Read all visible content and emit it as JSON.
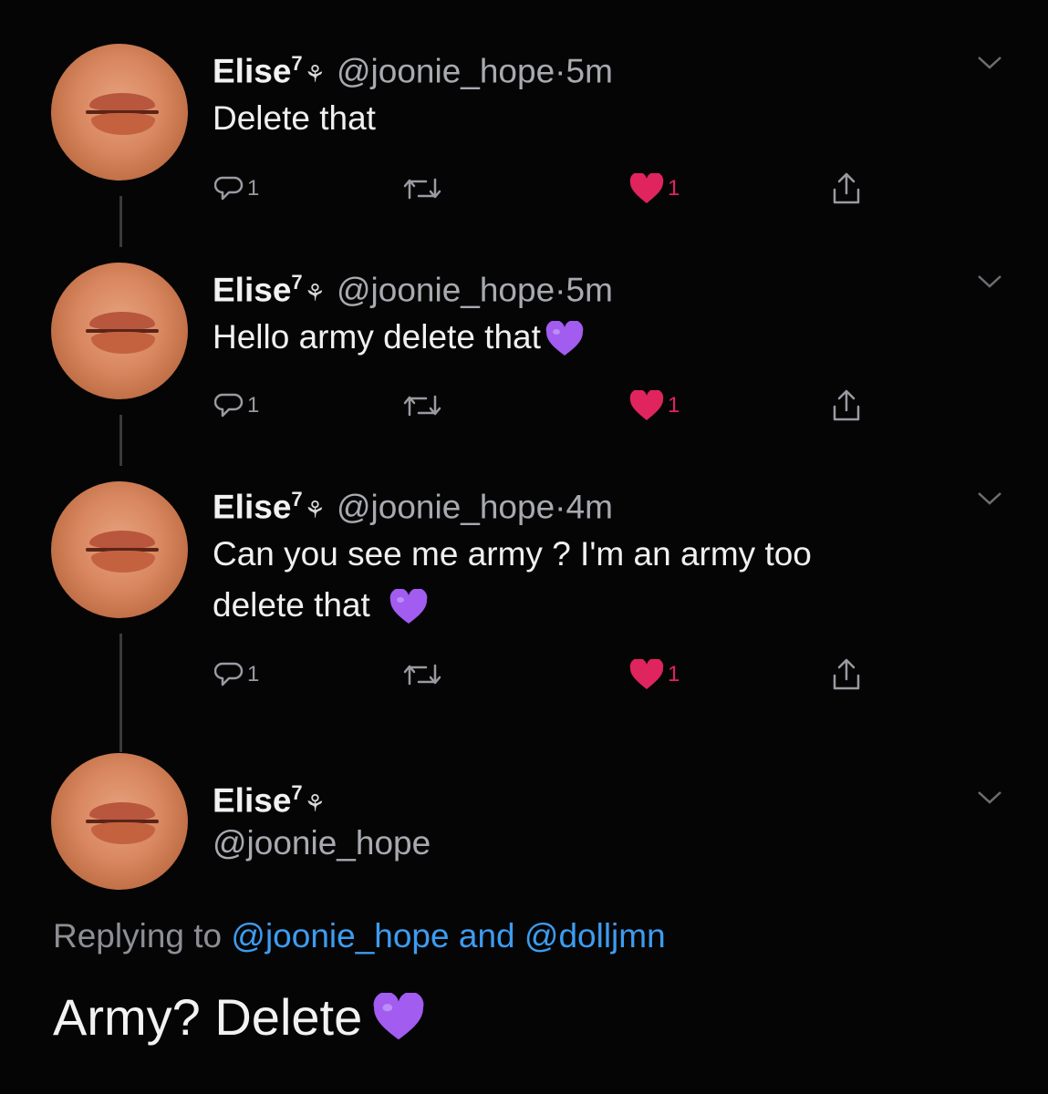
{
  "tweets": [
    {
      "name": "Elise",
      "superscript": "7",
      "rose": "⚘",
      "handle": "@joonie_hope",
      "dot": "·",
      "time": "5m",
      "text": "Delete that",
      "has_heart_emoji": false,
      "reply_count": "1",
      "like_count": "1"
    },
    {
      "name": "Elise",
      "superscript": "7",
      "rose": "⚘",
      "handle": "@joonie_hope",
      "dot": "·",
      "time": "5m",
      "text": "Hello army delete that",
      "has_heart_emoji": true,
      "reply_count": "1",
      "like_count": "1"
    },
    {
      "name": "Elise",
      "superscript": "7",
      "rose": "⚘",
      "handle": "@joonie_hope",
      "dot": "·",
      "time": "4m",
      "text_line1": "Can you see me army ? I'm an army too",
      "text_line2": "delete that",
      "has_heart_emoji": true,
      "reply_count": "1",
      "like_count": "1"
    }
  ],
  "main_tweet": {
    "name": "Elise",
    "superscript": "7",
    "rose": "⚘",
    "handle": "@joonie_hope",
    "replying_prefix": "Replying to",
    "mention1": "@joonie_hope",
    "and": "and",
    "mention2": "@dolljmn",
    "text": "Army? Delete"
  },
  "icons": {
    "reply": "reply-bubble-icon",
    "retweet": "retweet-icon",
    "like": "heart-like-icon",
    "share": "share-icon",
    "more": "chevron-down-icon",
    "emoji": "purple-heart-emoji"
  },
  "colors": {
    "background": "#050506",
    "like_active": "#e0245e",
    "mention": "#3d9cf0",
    "purple_heart": "#a25cf0"
  }
}
